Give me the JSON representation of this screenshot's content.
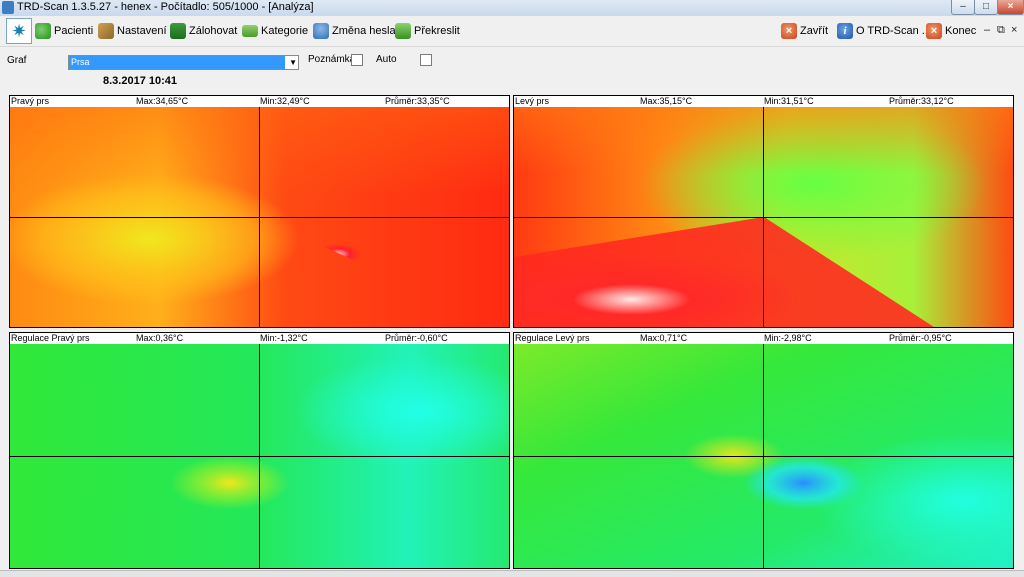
{
  "window": {
    "title": "TRD-Scan 1.3.5.27  - henex - Počítadlo: 505/1000 - [Analýza]"
  },
  "toolbar": {
    "items": [
      {
        "label": "Pacienti",
        "icon": "patients-icon"
      },
      {
        "label": "Nastavení",
        "icon": "tools-icon"
      },
      {
        "label": "Zálohovat",
        "icon": "backup-icon"
      },
      {
        "label": "Kategorie",
        "icon": "folder-icon"
      },
      {
        "label": "Změna hesla",
        "icon": "user-key-icon"
      },
      {
        "label": "Překreslit",
        "icon": "refresh-icon"
      }
    ],
    "right_items": [
      {
        "label": "Zavřít",
        "icon": "close-icon"
      },
      {
        "label": "O TRD-Scan ...",
        "icon": "info-icon"
      },
      {
        "label": "Konec",
        "icon": "close-icon"
      }
    ]
  },
  "controls": {
    "graph_label": "Graf",
    "graph_value": "Prsa",
    "note_label": "Poznámka",
    "note_checked": false,
    "auto_label": "Auto",
    "auto_checked": false,
    "datetime": "8.3.2017 10:41"
  },
  "panels": [
    {
      "name": "Pravý prs",
      "max": "Max:34,65°C",
      "min": "Min:32,49°C",
      "avg": "Průměr:33,35°C"
    },
    {
      "name": "Levý prs",
      "max": "Max:35,15°C",
      "min": "Min:31,51°C",
      "avg": "Průměr:33,12°C"
    },
    {
      "name": "Regulace Pravý prs",
      "max": "Max:0,36°C",
      "min": "Min:-1,32°C",
      "avg": "Průměr:-0,60°C"
    },
    {
      "name": "Regulace Levý prs",
      "max": "Max:0,71°C",
      "min": "Min:-2,98°C",
      "avg": "Průměr:-0,95°C"
    }
  ],
  "colors": {
    "accent": "#3399ff",
    "heat_red": "#ff2a12",
    "heat_orange": "#ff7a10",
    "heat_yellow": "#e6e61a",
    "heat_green": "#22e63a",
    "heat_cyan": "#22ffdd"
  }
}
